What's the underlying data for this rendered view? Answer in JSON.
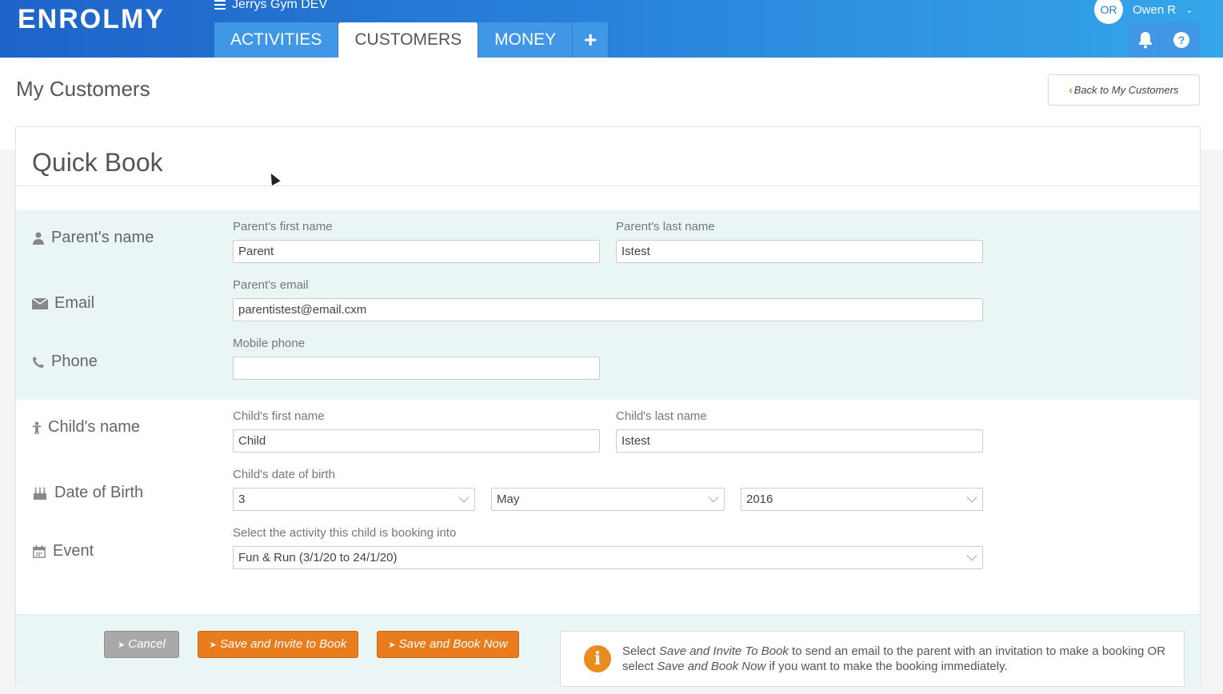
{
  "header": {
    "logo": "ENROLMY",
    "gym_name": "Jerrys Gym DEV",
    "tabs": [
      "ACTIVITIES",
      "CUSTOMERS",
      "MONEY"
    ],
    "active_tab": "CUSTOMERS",
    "add_tab": "+",
    "user_initials": "OR",
    "user_name": "Owen R"
  },
  "page": {
    "title": "My Customers",
    "back_button": "Back to My Customers"
  },
  "card": {
    "title": "Quick Book",
    "rows": {
      "parent_name": "Parent's name",
      "email": "Email",
      "phone": "Phone",
      "child_name": "Child's name",
      "dob": "Date of Birth",
      "event": "Event"
    },
    "fields": {
      "parent_first_label": "Parent's first name",
      "parent_first_value": "Parent",
      "parent_last_label": "Parent's last name",
      "parent_last_value": "Istest",
      "email_label": "Parent's email",
      "email_value": "parentistest@email.cxm",
      "phone_label": "Mobile phone",
      "phone_value": "",
      "child_first_label": "Child's first name",
      "child_first_value": "Child",
      "child_last_label": "Child's last name",
      "child_last_value": "Istest",
      "dob_label": "Child's date of birth",
      "dob_day": "3",
      "dob_month": "May",
      "dob_year": "2016",
      "event_label": "Select the activity this child is booking into",
      "event_value": "Fun & Run (3/1/20 to 24/1/20)"
    },
    "buttons": {
      "cancel": "Cancel",
      "save_invite": "Save and Invite to Book",
      "save_book": "Save and Book Now"
    },
    "info": {
      "t1": "Select ",
      "em1": "Save and Invite To Book",
      "t2": " to send an email to the parent with an invitation to make a booking OR select ",
      "em2": "Save and Book Now",
      "t3": " if you want to make the booking immediately."
    }
  }
}
